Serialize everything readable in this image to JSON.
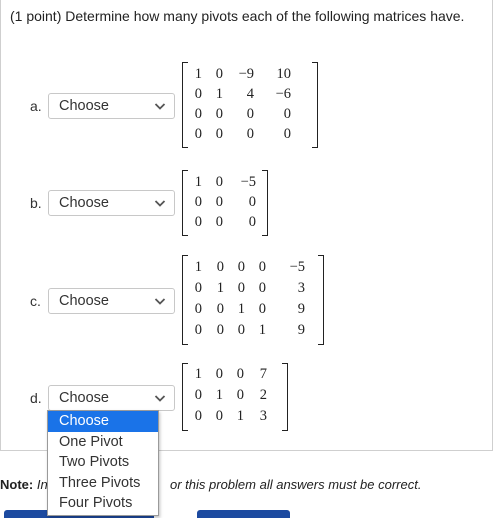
{
  "header": {
    "text": "(1 point) Determine how many pivots each of the following matrices have."
  },
  "parts": [
    {
      "label": "a.",
      "selected": "Choose",
      "matrix": [
        [
          "1",
          "0",
          "−9",
          "10"
        ],
        [
          "0",
          "1",
          "4",
          "−6"
        ],
        [
          "0",
          "0",
          "0",
          "0"
        ],
        [
          "0",
          "0",
          "0",
          "0"
        ]
      ]
    },
    {
      "label": "b.",
      "selected": "Choose",
      "matrix": [
        [
          "1",
          "0",
          "−5"
        ],
        [
          "0",
          "0",
          "0"
        ],
        [
          "0",
          "0",
          "0"
        ]
      ]
    },
    {
      "label": "c.",
      "selected": "Choose",
      "matrix": [
        [
          "1",
          "0",
          "0",
          "0",
          "−5"
        ],
        [
          "0",
          "1",
          "0",
          "0",
          "3"
        ],
        [
          "0",
          "0",
          "1",
          "0",
          "9"
        ],
        [
          "0",
          "0",
          "0",
          "1",
          "9"
        ]
      ]
    },
    {
      "label": "d.",
      "selected": "Choose",
      "matrix": [
        [
          "1",
          "0",
          "0",
          "7"
        ],
        [
          "0",
          "1",
          "0",
          "2"
        ],
        [
          "0",
          "0",
          "1",
          "3"
        ]
      ]
    }
  ],
  "dropdown": {
    "options": [
      "Choose",
      "One Pivot",
      "Two Pivots",
      "Three Pivots",
      "Four Pivots"
    ],
    "highlighted": "Choose"
  },
  "note": {
    "bold": "Note:",
    "visible_start": "In",
    "visible_end": "or this problem all answers must be correct."
  }
}
